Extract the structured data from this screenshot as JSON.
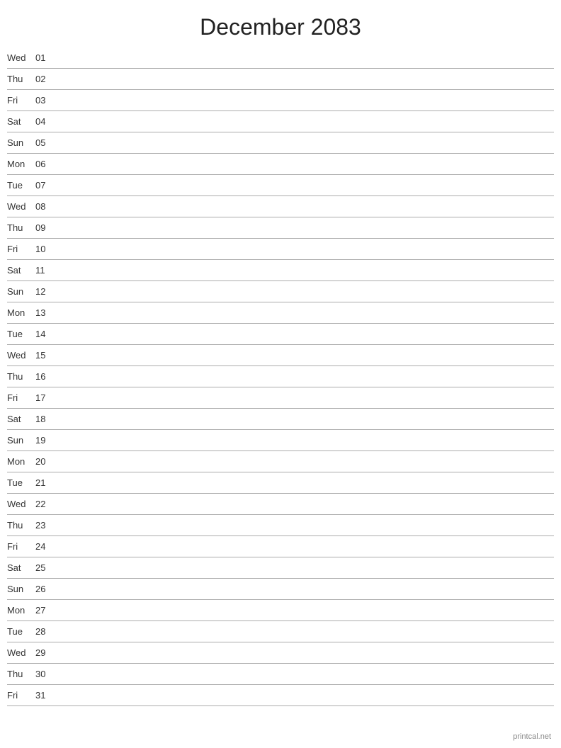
{
  "title": "December 2083",
  "days": [
    {
      "name": "Wed",
      "num": "01"
    },
    {
      "name": "Thu",
      "num": "02"
    },
    {
      "name": "Fri",
      "num": "03"
    },
    {
      "name": "Sat",
      "num": "04"
    },
    {
      "name": "Sun",
      "num": "05"
    },
    {
      "name": "Mon",
      "num": "06"
    },
    {
      "name": "Tue",
      "num": "07"
    },
    {
      "name": "Wed",
      "num": "08"
    },
    {
      "name": "Thu",
      "num": "09"
    },
    {
      "name": "Fri",
      "num": "10"
    },
    {
      "name": "Sat",
      "num": "11"
    },
    {
      "name": "Sun",
      "num": "12"
    },
    {
      "name": "Mon",
      "num": "13"
    },
    {
      "name": "Tue",
      "num": "14"
    },
    {
      "name": "Wed",
      "num": "15"
    },
    {
      "name": "Thu",
      "num": "16"
    },
    {
      "name": "Fri",
      "num": "17"
    },
    {
      "name": "Sat",
      "num": "18"
    },
    {
      "name": "Sun",
      "num": "19"
    },
    {
      "name": "Mon",
      "num": "20"
    },
    {
      "name": "Tue",
      "num": "21"
    },
    {
      "name": "Wed",
      "num": "22"
    },
    {
      "name": "Thu",
      "num": "23"
    },
    {
      "name": "Fri",
      "num": "24"
    },
    {
      "name": "Sat",
      "num": "25"
    },
    {
      "name": "Sun",
      "num": "26"
    },
    {
      "name": "Mon",
      "num": "27"
    },
    {
      "name": "Tue",
      "num": "28"
    },
    {
      "name": "Wed",
      "num": "29"
    },
    {
      "name": "Thu",
      "num": "30"
    },
    {
      "name": "Fri",
      "num": "31"
    }
  ],
  "footer": "printcal.net"
}
